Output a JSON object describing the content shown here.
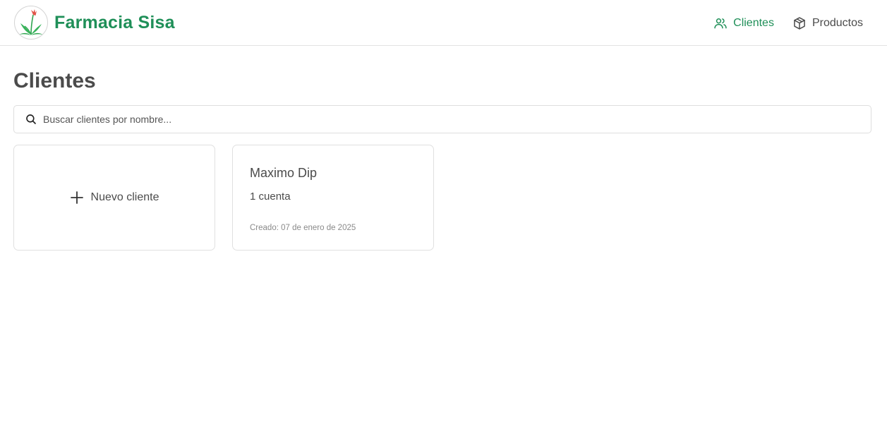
{
  "header": {
    "brand_name": "Farmacia Sisa",
    "nav": [
      {
        "label": "Clientes",
        "icon": "users-icon",
        "active": true
      },
      {
        "label": "Productos",
        "icon": "package-icon",
        "active": false
      }
    ]
  },
  "main": {
    "title": "Clientes",
    "search": {
      "placeholder": "Buscar clientes por nombre...",
      "value": ""
    },
    "new_client_label": "Nuevo cliente",
    "clients": [
      {
        "name": "Maximo Dip",
        "accounts": "1 cuenta",
        "created": "Creado: 07 de enero de 2025"
      }
    ]
  },
  "colors": {
    "brand": "#1f8f58",
    "text": "#4b4b4b",
    "muted": "#8a8a8a",
    "border": "#e0e0e0"
  }
}
